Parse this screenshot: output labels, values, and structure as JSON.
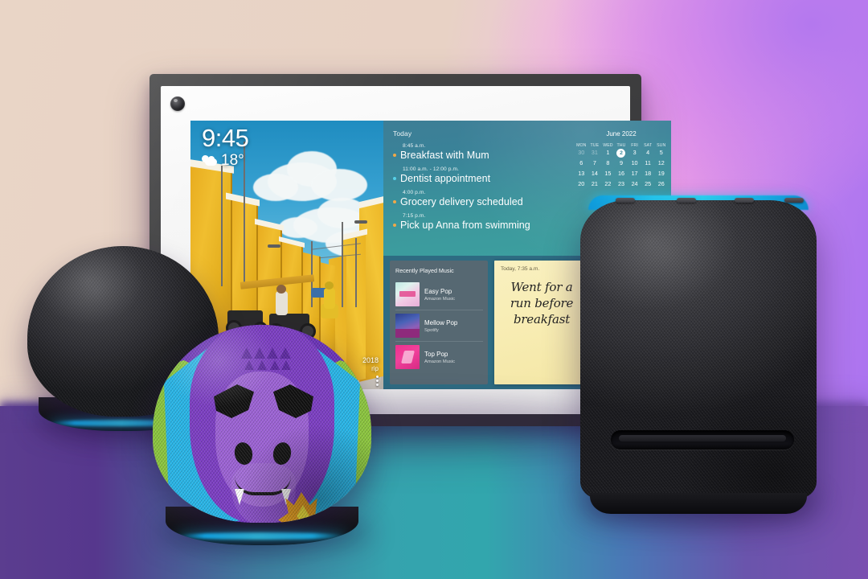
{
  "scene": {
    "title": "Amazon Echo device family product shot",
    "background": {
      "upper_colors": [
        "#e9d5c6",
        "#f49ae8",
        "#b478ee"
      ],
      "lower_colors": [
        "#5b3d8f",
        "#32a6ad",
        "#7a4fb0"
      ]
    }
  },
  "show_device": {
    "name": "Echo Show 15",
    "bezel_color": "#3b3b3e",
    "camera_label": "camera"
  },
  "screen": {
    "clock": {
      "time": "9:45",
      "temperature": "18°",
      "weather_icon": "partly-cloudy-icon"
    },
    "photo": {
      "caption_line1": "2018",
      "caption_line2": "rip",
      "menu_icon": "kebab-menu-icon"
    },
    "agenda": {
      "heading": "Today",
      "events": [
        {
          "time": "8:45 a.m.",
          "title": "Breakfast with Mum",
          "dot_color": "#f0a848"
        },
        {
          "time": "11:00 a.m. - 12:00 p.m.",
          "title": "Dentist appointment",
          "dot_color": "#56d0e8"
        },
        {
          "time": "4:00 p.m.",
          "title": "Grocery delivery scheduled",
          "dot_color": "#f0a848"
        },
        {
          "time": "7:15 p.m.",
          "title": "Pick up Anna from swimming",
          "dot_color": "#f0a848"
        }
      ]
    },
    "calendar": {
      "title": "June 2022",
      "day_headers": [
        "MON",
        "TUE",
        "WED",
        "THU",
        "FRI",
        "SAT",
        "SUN"
      ],
      "weeks": [
        [
          {
            "day": "30",
            "muted": true
          },
          {
            "day": "31",
            "muted": true
          },
          {
            "day": "1",
            "muted": false
          },
          {
            "day": "2",
            "muted": false,
            "today": true
          },
          {
            "day": "3",
            "muted": false
          },
          {
            "day": "4",
            "muted": false
          },
          {
            "day": "5",
            "muted": false
          }
        ],
        [
          {
            "day": "6"
          },
          {
            "day": "7"
          },
          {
            "day": "8"
          },
          {
            "day": "9"
          },
          {
            "day": "10"
          },
          {
            "day": "11"
          },
          {
            "day": "12"
          }
        ],
        [
          {
            "day": "13"
          },
          {
            "day": "14"
          },
          {
            "day": "15"
          },
          {
            "day": "16"
          },
          {
            "day": "17"
          },
          {
            "day": "18"
          },
          {
            "day": "19"
          }
        ],
        [
          {
            "day": "20"
          },
          {
            "day": "21"
          },
          {
            "day": "22"
          },
          {
            "day": "23"
          },
          {
            "day": "24"
          },
          {
            "day": "25"
          },
          {
            "day": "26"
          }
        ]
      ],
      "today_highlight_color": "#ffffff"
    },
    "music": {
      "heading": "Recently Played Music",
      "tracks": [
        {
          "name": "Easy Pop",
          "source": "Amazon Music",
          "art": "art-a"
        },
        {
          "name": "Mellow Pop",
          "source": "Spotify",
          "art": "art-b"
        },
        {
          "name": "Top Pop",
          "source": "Amazon Music",
          "art": "art-c"
        }
      ]
    },
    "note": {
      "timestamp": "Today, 7:35 a.m.",
      "body": "Went for a run before breakfast",
      "paper_color": "#f8edb4"
    }
  },
  "devices": [
    {
      "name": "Echo Dot (charcoal)",
      "led_color": "#2ad6f5"
    },
    {
      "name": "Echo Dot Kids (dragon)",
      "led_color": "#2fd9f8"
    },
    {
      "name": "Echo Studio",
      "led_color": "#2ad6f6"
    }
  ]
}
